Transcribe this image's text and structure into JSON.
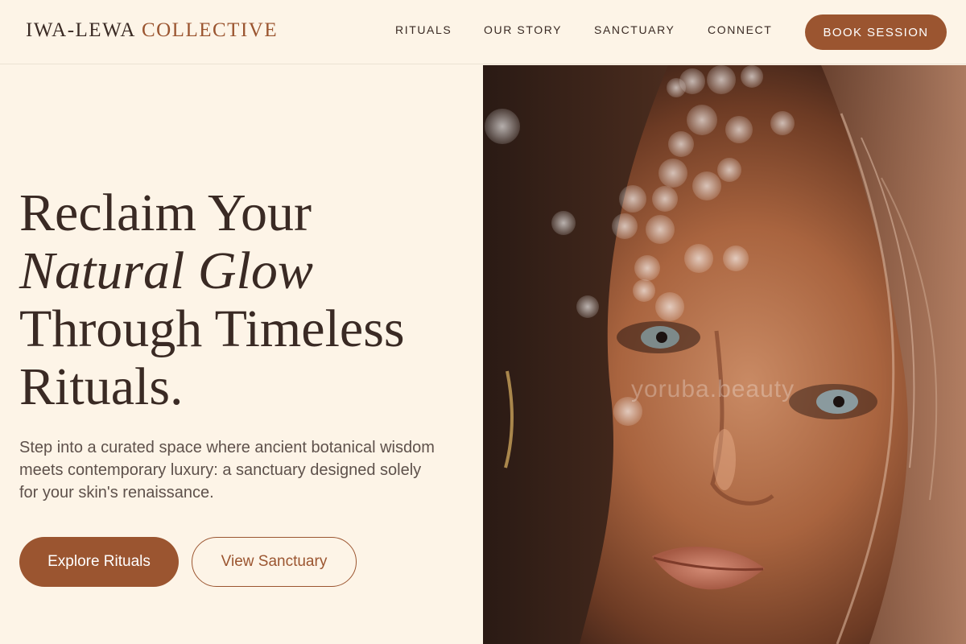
{
  "brand": {
    "name_part1": "IWA-LEWA",
    "name_part2": "COLLECTIVE",
    "accent_color": "#9b5530"
  },
  "nav": {
    "items": [
      {
        "label": "RITUALS"
      },
      {
        "label": "OUR STORY"
      },
      {
        "label": "SANCTUARY"
      },
      {
        "label": "CONNECT"
      }
    ],
    "cta_label": "BOOK SESSION"
  },
  "hero": {
    "headline_line1": "Reclaim Your",
    "headline_line2_italic": "Natural Glow",
    "headline_line3": "Through Timeless",
    "headline_line4": "Rituals.",
    "subtext": "Step into a curated space where ancient botanical wisdom meets contemporary luxury: a sanctuary designed solely for your skin's renaissance.",
    "primary_button": "Explore Rituals",
    "secondary_button": "View Sanctuary",
    "image_watermark": "yoruba.beauty"
  },
  "colors": {
    "background": "#fdf4e7",
    "text_dark": "#3a2a24",
    "text_muted": "#5e514b",
    "accent": "#9b5530"
  }
}
